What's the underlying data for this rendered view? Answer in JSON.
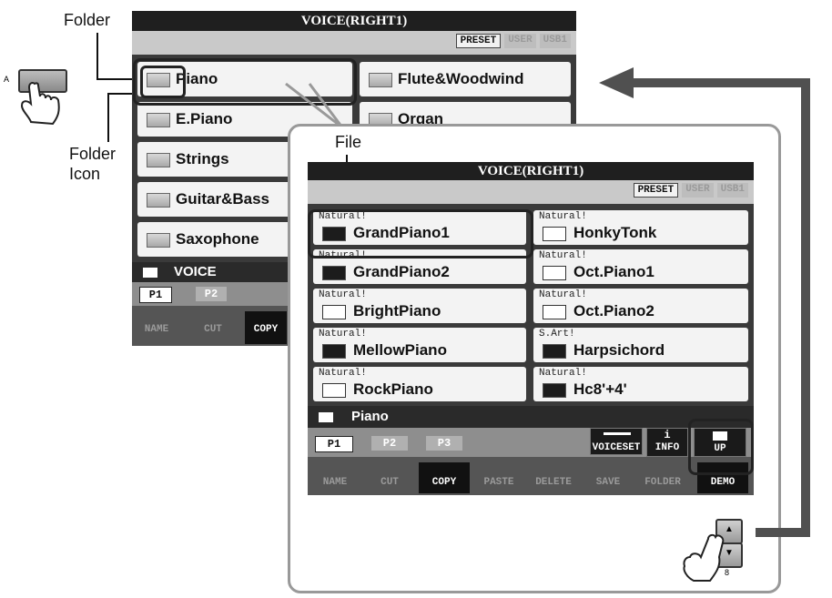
{
  "callouts": {
    "folder": "Folder",
    "folder_icon_line1": "Folder",
    "folder_icon_line2": "Icon",
    "file": "File",
    "label_a": "A",
    "label_8": "8"
  },
  "back_screen": {
    "title": "VOICE(RIGHT1)",
    "tabs": [
      "PRESET",
      "USER",
      "USB1"
    ],
    "active_tab": "PRESET",
    "folders": [
      "Piano",
      "E.Piano",
      "Strings",
      "Guitar&Bass",
      "Saxophone"
    ],
    "folders_right": [
      "Flute&Woodwind",
      "Organ"
    ],
    "path": "VOICE",
    "pages": [
      "P1",
      "P2"
    ],
    "functions": [
      "NAME",
      "CUT",
      "COPY"
    ]
  },
  "front_screen": {
    "title": "VOICE(RIGHT1)",
    "tabs": [
      "PRESET",
      "USER",
      "USB1"
    ],
    "active_tab": "PRESET",
    "files": [
      {
        "tag": "Natural!",
        "name": "GrandPiano1"
      },
      {
        "tag": "Natural!",
        "name": "HonkyTonk"
      },
      {
        "tag": "Natural!",
        "name": "GrandPiano2"
      },
      {
        "tag": "Natural!",
        "name": "Oct.Piano1"
      },
      {
        "tag": "Natural!",
        "name": "BrightPiano"
      },
      {
        "tag": "Natural!",
        "name": "Oct.Piano2"
      },
      {
        "tag": "Natural!",
        "name": "MellowPiano"
      },
      {
        "tag": "S.Art!",
        "name": "Harpsichord"
      },
      {
        "tag": "Natural!",
        "name": "RockPiano"
      },
      {
        "tag": "Natural!",
        "name": "Hc8'+4'"
      }
    ],
    "path": "Piano",
    "pages": [
      "P1",
      "P2",
      "P3"
    ],
    "voiceset": "VOICESET",
    "info": "INFO",
    "info_glyph": "i",
    "up": "UP",
    "functions": [
      "NAME",
      "CUT",
      "COPY",
      "PASTE",
      "DELETE",
      "SAVE",
      "FOLDER",
      "DEMO"
    ]
  }
}
